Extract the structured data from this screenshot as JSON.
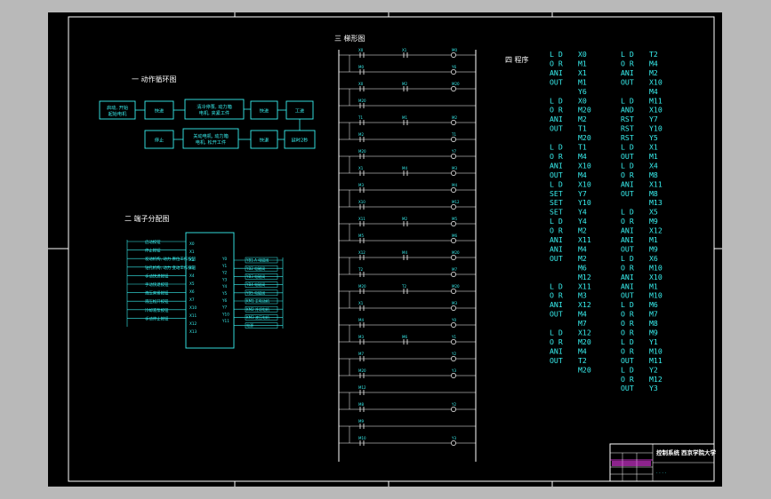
{
  "titles": {
    "cycle": "一  动作循环图",
    "terminal": "二  端子分配图",
    "ladder": "三  梯形图",
    "program": "四  程序"
  },
  "flow_boxes": [
    "启动, 开始 起始电机",
    "快进",
    "清冷停泵, 动力箱 电机, 夹紧工件",
    "快进",
    "工进",
    "停止",
    "关动电机, 动力箱 电机, 松开工件",
    "快退",
    "延时2秒"
  ],
  "terminal": {
    "left_labels": [
      "启动按钮",
      "停止按钮",
      "发动机构, 动力 原位工作按钮",
      "钻孔机构, 动力 变动工作按钮",
      "手动快进按钮",
      "手动快退按钮",
      "液压夹紧按钮",
      "液压松开按钮",
      "冷却液泵按钮",
      "手动停止按钮"
    ],
    "plc_in": [
      "X0",
      "X1",
      "X2",
      "X3",
      "X4",
      "X5",
      "X6",
      "X7",
      "X10",
      "X11",
      "X12",
      "X13"
    ],
    "plc_out": [
      "Y0",
      "Y1",
      "Y2",
      "Y3",
      "Y4",
      "Y5",
      "Y6",
      "Y7",
      "Y10",
      "Y11",
      "Y12",
      "Y13"
    ],
    "right_labels": [
      "YB1-A 电磁阀",
      "YB2 电磁阀",
      "YB3 电磁阀",
      "YB4 电磁阀",
      "YB5 电磁阀",
      "KM1 主电动机",
      "KM2 冷却电机",
      "KM3 液压电机",
      "电源"
    ]
  },
  "ladder_rungs": [
    {
      "c1": "X0",
      "c2": "X1",
      "coil": "M0"
    },
    {
      "c1": "M0",
      "c2": "",
      "coil": "Y6"
    },
    {
      "c1": "X0",
      "c2": "M2",
      "coil": "M20"
    },
    {
      "c1": "M20",
      "c2": "",
      "coil": ""
    },
    {
      "c1": "T1",
      "c2": "M1",
      "coil": "M2"
    },
    {
      "c1": "M2",
      "c2": "",
      "coil": "T1"
    },
    {
      "c1": "M20",
      "c2": "",
      "coil": "Y7"
    },
    {
      "c1": "X1",
      "c2": "M4",
      "coil": "M3"
    },
    {
      "c1": "M3",
      "c2": "",
      "coil": "M4"
    },
    {
      "c1": "X10",
      "c2": "",
      "coil": "M12"
    },
    {
      "c1": "X11",
      "c2": "M2",
      "coil": "M5"
    },
    {
      "c1": "M5",
      "c2": "",
      "coil": "M6"
    },
    {
      "c1": "X12",
      "c2": "M4",
      "coil": "M20"
    },
    {
      "c1": "T2",
      "c2": "",
      "coil": "M7"
    },
    {
      "c1": "M20",
      "c2": "T2",
      "coil": "M20"
    },
    {
      "c1": "X1",
      "c2": "",
      "coil": "M3"
    },
    {
      "c1": "M4",
      "c2": "",
      "coil": "Y0"
    },
    {
      "c1": "M3",
      "c2": "M6",
      "coil": "Y1"
    },
    {
      "c1": "M7",
      "c2": "",
      "coil": "Y2"
    },
    {
      "c1": "M20",
      "c2": "",
      "coil": "Y3"
    },
    {
      "c1": "M12",
      "c2": "",
      "coil": ""
    },
    {
      "c1": "M8",
      "c2": "",
      "coil": "Y2"
    },
    {
      "c1": "M9",
      "c2": "",
      "coil": ""
    },
    {
      "c1": "M10",
      "c2": "",
      "coil": "Y3"
    }
  ],
  "program": {
    "col1": [
      "L D",
      "O R",
      "ANI",
      "OUT",
      "",
      "L D",
      "O R",
      "ANI",
      "OUT",
      "",
      "L D",
      "O R",
      "ANI",
      "OUT",
      "L D",
      "SET",
      "SET",
      "SET",
      "L D",
      "O R",
      "ANI",
      "ANI",
      "OUT",
      "",
      "",
      "L D",
      "O R",
      "ANI",
      "OUT",
      "",
      "L D",
      "O R",
      "ANI",
      "OUT",
      ""
    ],
    "col1v": [
      "X0",
      "M1",
      "X1",
      "M1",
      "Y6",
      "X0",
      "M20",
      "M2",
      "T1",
      "M20",
      "T1",
      "M4",
      "X10",
      "M4",
      "X10",
      "Y7",
      "Y10",
      "Y4",
      "Y4",
      "M2",
      "X11",
      "M4",
      "M2",
      "M6",
      "M12",
      "X11",
      "M3",
      "X12",
      "M4",
      "M7",
      "X12",
      "M20",
      "M4",
      "T2",
      "M20"
    ],
    "col2": [
      "L D",
      "O R",
      "ANI",
      "OUT",
      "",
      "L D",
      "AND",
      "RST",
      "RST",
      "RST",
      "L D",
      "OUT",
      "L D",
      "O R",
      "ANI",
      "OUT",
      "",
      "L D",
      "O R",
      "ANI",
      "ANI",
      "OUT",
      "L D",
      "O R",
      "ANI",
      "ANI",
      "OUT",
      "L D",
      "O R",
      "O R",
      "O R",
      "L D",
      "O R",
      "OUT",
      "L D",
      "O R",
      "OUT"
    ],
    "col2v": [
      "T2",
      "M4",
      "M2",
      "X10",
      "M4",
      "M11",
      "X10",
      "Y7",
      "Y10",
      "Y5",
      "X1",
      "M1",
      "X4",
      "M8",
      "X11",
      "M8",
      "M13",
      "X5",
      "M9",
      "X12",
      "M1",
      "M9",
      "X6",
      "M10",
      "X10",
      "M1",
      "M10",
      "M6",
      "M7",
      "M8",
      "M9",
      "Y1",
      "M10",
      "M11",
      "Y2",
      "M12",
      "Y3"
    ]
  },
  "title_block": {
    "line1": "控制系统",
    "line2": "西京学院大学"
  }
}
